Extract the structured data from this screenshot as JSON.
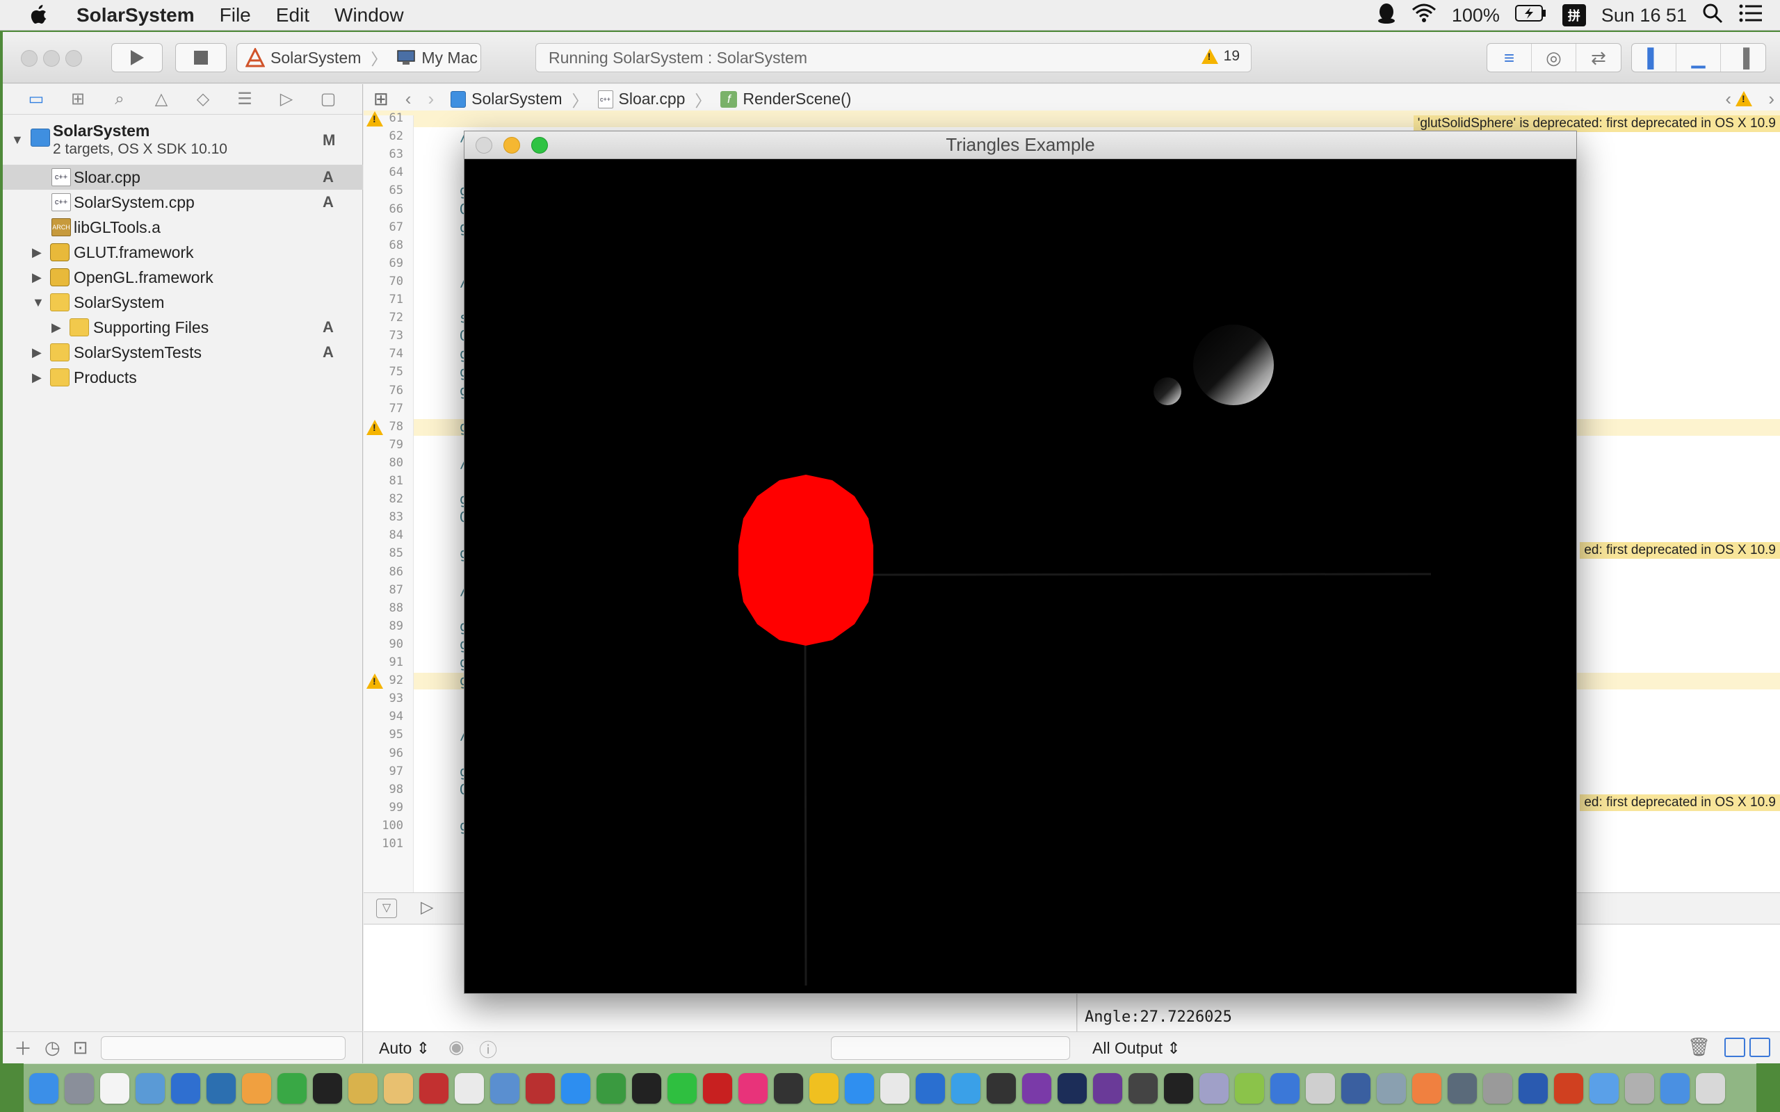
{
  "menubar": {
    "app_name": "SolarSystem",
    "menus": [
      "File",
      "Edit",
      "Window"
    ],
    "battery": "100%",
    "input_method": "拼",
    "clock": "Sun 16 51"
  },
  "toolbar": {
    "scheme_project": "SolarSystem",
    "scheme_destination": "My Mac",
    "status_text": "Running SolarSystem : SolarSystem",
    "warning_count": "19"
  },
  "navigator": {
    "items": [
      {
        "label": "SolarSystem",
        "subtitle": "2 targets, OS X SDK 10.10",
        "badge": "M",
        "icon": "project-icon"
      },
      {
        "label": "Sloar.cpp",
        "badge": "A",
        "icon": "cpp-file-icon",
        "selected": true
      },
      {
        "label": "SolarSystem.cpp",
        "badge": "A",
        "icon": "cpp-file-icon"
      },
      {
        "label": "libGLTools.a",
        "badge": "",
        "icon": "library-icon"
      },
      {
        "label": "GLUT.framework",
        "badge": "",
        "icon": "framework-icon"
      },
      {
        "label": "OpenGL.framework",
        "badge": "",
        "icon": "framework-icon"
      },
      {
        "label": "SolarSystem",
        "badge": "",
        "icon": "folder-icon"
      },
      {
        "label": "Supporting Files",
        "badge": "A",
        "icon": "folder-icon"
      },
      {
        "label": "SolarSystemTests",
        "badge": "A",
        "icon": "folder-icon"
      },
      {
        "label": "Products",
        "badge": "",
        "icon": "folder-icon"
      }
    ],
    "lib_icon_text": "ARCH"
  },
  "jumpbar": {
    "project": "SolarSystem",
    "file": "Sloar.cpp",
    "function": "RenderScene()",
    "function_badge": "f"
  },
  "editor": {
    "line_numbers": [
      "61",
      "62",
      "63",
      "64",
      "65",
      "66",
      "67",
      "68",
      "69",
      "70",
      "71",
      "72",
      "73",
      "74",
      "75",
      "76",
      "77",
      "78",
      "79",
      "80",
      "81",
      "82",
      "83",
      "84",
      "85",
      "86",
      "87",
      "88",
      "89",
      "90",
      "91",
      "92",
      "93",
      "94",
      "95",
      "96",
      "97",
      "98",
      "99",
      "100",
      "101"
    ],
    "code_glyphs": {
      "62": "/",
      "65": "g",
      "66": "G",
      "67": "g",
      "70": "/",
      "72": "s",
      "73": "G",
      "74": "g",
      "75": "g",
      "76": "g",
      "78": "g",
      "80": "/",
      "82": "g",
      "83": "G",
      "85": "g",
      "87": "/",
      "89": "g",
      "90": "g",
      "91": "g",
      "92": "g",
      "95": "/",
      "97": "g",
      "98": "G",
      "100": "g"
    },
    "issues": {
      "top": "'glutSolidSphere' is deprecated: first deprecated in OS X 10.9",
      "line78": "ed: first deprecated in OS X 10.9",
      "line92": "ed: first deprecated in OS X 10.9"
    }
  },
  "debug": {
    "console_output": "Angle:27.7226025",
    "scope": "Auto",
    "output_filter": "All Output"
  },
  "gl_window": {
    "title": "Triangles Example"
  },
  "colors": {
    "sun": "#ff0000",
    "warning": "#f5b400",
    "accent": "#2f7ee0"
  }
}
